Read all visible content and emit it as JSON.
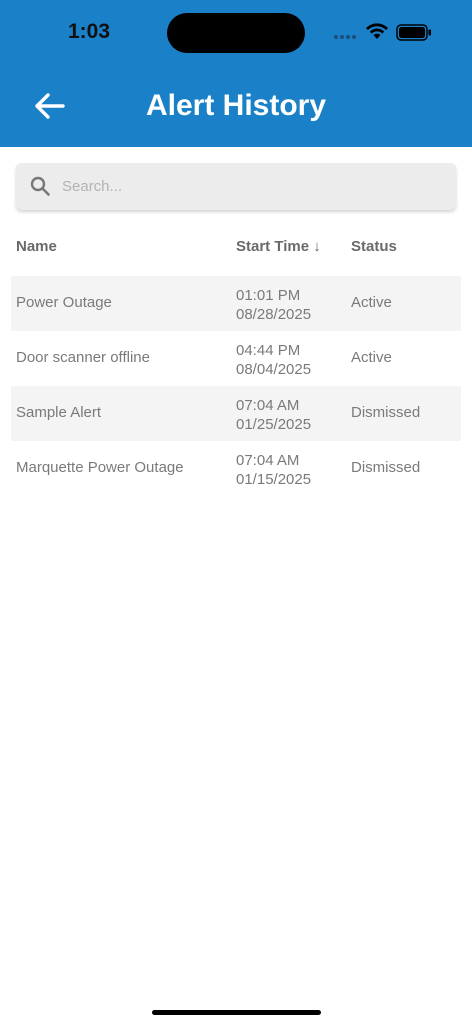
{
  "status_bar": {
    "time": "1:03"
  },
  "header": {
    "title": "Alert History",
    "back_icon": "arrow-left-icon",
    "color": "#1a80c7"
  },
  "search": {
    "placeholder": "Search...",
    "value": "",
    "icon": "search-icon"
  },
  "table": {
    "columns": {
      "name": "Name",
      "start_time": "Start Time ↓",
      "status": "Status"
    },
    "rows": [
      {
        "name": "Power Outage",
        "time": "01:01 PM",
        "date": "08/28/2025",
        "status": "Active"
      },
      {
        "name": "Door scanner offline",
        "time": "04:44 PM",
        "date": "08/04/2025",
        "status": "Active"
      },
      {
        "name": "Sample Alert",
        "time": "07:04 AM",
        "date": "01/25/2025",
        "status": "Dismissed"
      },
      {
        "name": "Marquette Power Outage",
        "time": "07:04 AM",
        "date": "01/15/2025",
        "status": "Dismissed"
      }
    ]
  }
}
